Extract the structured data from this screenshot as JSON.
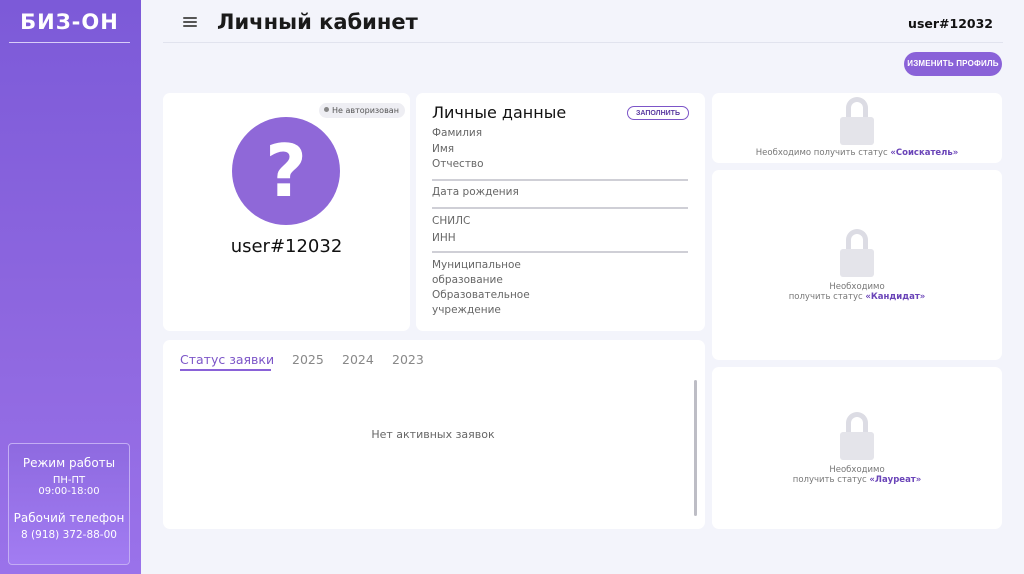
{
  "sidebar": {
    "logo": "БИЗ-ОН",
    "work_hours": {
      "title": "Режим работы",
      "days": "ПН-ПТ",
      "hours": "09:00-18:00",
      "phone_title": "Рабочий телефон",
      "phone": "8 (918) 372-88-00"
    }
  },
  "header": {
    "title": "Личный кабинет",
    "user": "user#12032"
  },
  "actions": {
    "edit_profile": "ИЗМЕНИТЬ ПРОФИЛЬ"
  },
  "profile": {
    "badge": "Не авторизован",
    "avatar_symbol": "?",
    "name": "user#12032"
  },
  "personal": {
    "title": "Личные данные",
    "fill_button": "ЗАПОЛНИТЬ",
    "fields": {
      "surname": "Фамилия",
      "name": "Имя",
      "patronymic": "Отчество",
      "birth_date": "Дата рождения",
      "snils": "СНИЛС",
      "inn": "ИНН",
      "municipality_1": "Муниципальное",
      "municipality_2": "образование",
      "school_1": "Образовательное",
      "school_2": "учреждение"
    }
  },
  "status": {
    "tabs": [
      "Статус заявки",
      "2025",
      "2024",
      "2023"
    ],
    "active_tab": 0,
    "empty": "Нет активных заявок"
  },
  "locks": [
    {
      "text": "Необходимо получить статус ",
      "status": "«Соискатель»"
    },
    {
      "text1": "Необходимо",
      "text2": "получить статус ",
      "status": "«Кандидат»"
    },
    {
      "text1": "Необходимо",
      "text2": "получить статус ",
      "status": "«Лауреат»"
    }
  ],
  "colors": {
    "accent": "#8a62d8",
    "sidebar": "#7c5ad8",
    "background": "#f3f4fb"
  }
}
